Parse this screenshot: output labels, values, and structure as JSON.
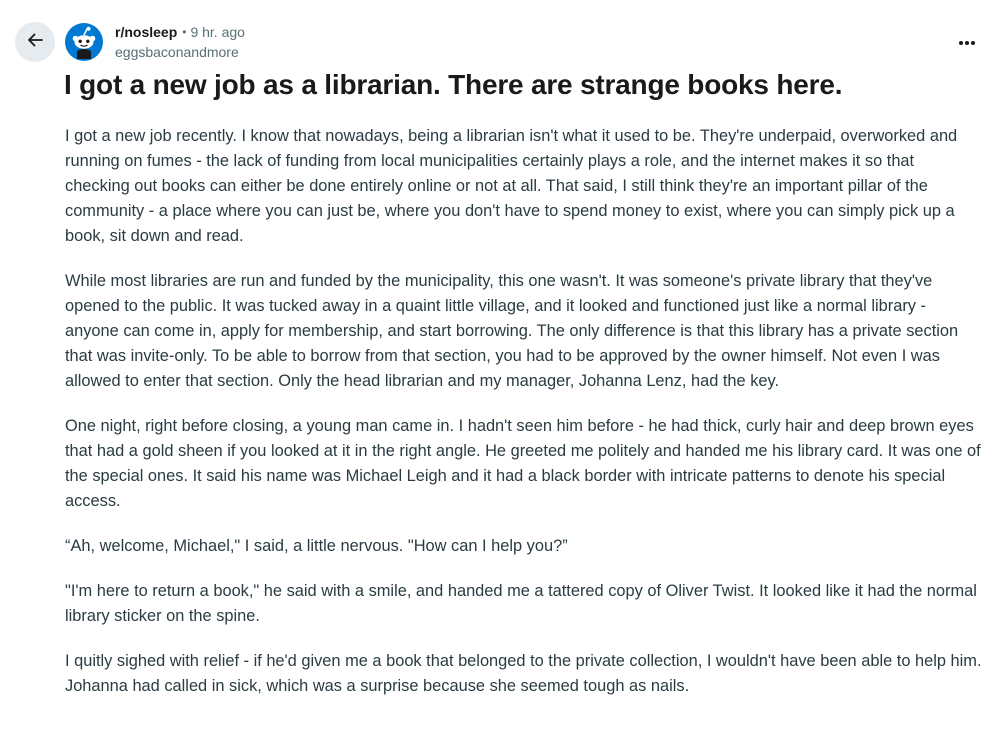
{
  "header": {
    "subreddit": "r/nosleep",
    "separator": "•",
    "time": "9 hr. ago",
    "author": "eggsbaconandmore"
  },
  "post": {
    "title": "I got a new job as a librarian. There are strange books here.",
    "paragraphs": [
      "I got a new job recently.   I know that nowadays, being a librarian isn't what it used to be. They're underpaid, overworked and running on fumes - the lack of funding from local municipalities certainly plays a role, and the internet makes it so that checking out books can either be done entirely online or not at all. That said, I still think they're an important pillar of the community - a place where you can just be, where you don't have to spend money to exist, where you can simply pick up a book, sit down and read.",
      "While most libraries are run and funded by the municipality, this one wasn't. It was someone's private library that they've opened to the public. It was tucked away in a quaint little village, and it looked and functioned just like a normal library - anyone can come in, apply for membership, and start borrowing. The only difference is that this library has a private section that was invite-only. To be able to borrow from that section, you had to be approved by the owner himself. Not even I was allowed to enter that section. Only the head librarian and my manager, Johanna Lenz, had the key.",
      "One night, right before closing, a young man came in. I hadn't seen him before - he had thick, curly hair and deep brown eyes that had a gold sheen if you looked at it in the right angle. He greeted me politely and handed me his library card. It was one of the special ones. It said his name was Michael Leigh and it had a black border with intricate patterns to denote his special access.",
      "“Ah, welcome, Michael,\" I said, a little nervous. \"How can I help you?”",
      "\"I'm here to return a book,\" he said with a smile, and handed me a tattered copy of Oliver Twist. It looked like it had the normal library sticker on the spine.",
      "I quitly sighed with relief - if he'd given me a book that belonged to the private collection, I wouldn't have been able to help him. Johanna had called in sick, which was a surprise because she seemed tough as nails."
    ]
  },
  "icons": {
    "back": "arrow-left-icon",
    "avatar": "reddit-snoo-icon",
    "more": "ellipsis-horizontal-icon"
  },
  "colors": {
    "avatar_bg": "#0079d3",
    "back_bg": "#e5ebee",
    "meta_text": "#576f76",
    "body_text": "#2a3c42",
    "title_text": "#1a1a1b"
  }
}
